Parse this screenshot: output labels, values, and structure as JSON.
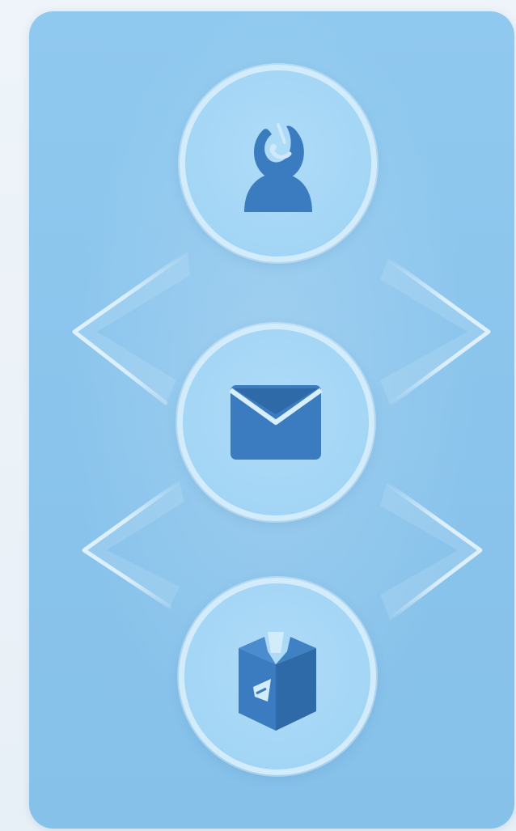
{
  "nodes": [
    {
      "id": "support",
      "icon": "support-agent-icon"
    },
    {
      "id": "mail",
      "icon": "envelope-icon"
    },
    {
      "id": "package",
      "icon": "package-box-icon"
    }
  ],
  "colors": {
    "panel": "#8ac4ec",
    "node_fill": "#a3d5f5",
    "node_ring": "#d3ecfb",
    "icon": "#3b7bbf",
    "icon_dark": "#2f6aa8",
    "connector": "#d6eefc",
    "page_background": "#eef4f9"
  }
}
